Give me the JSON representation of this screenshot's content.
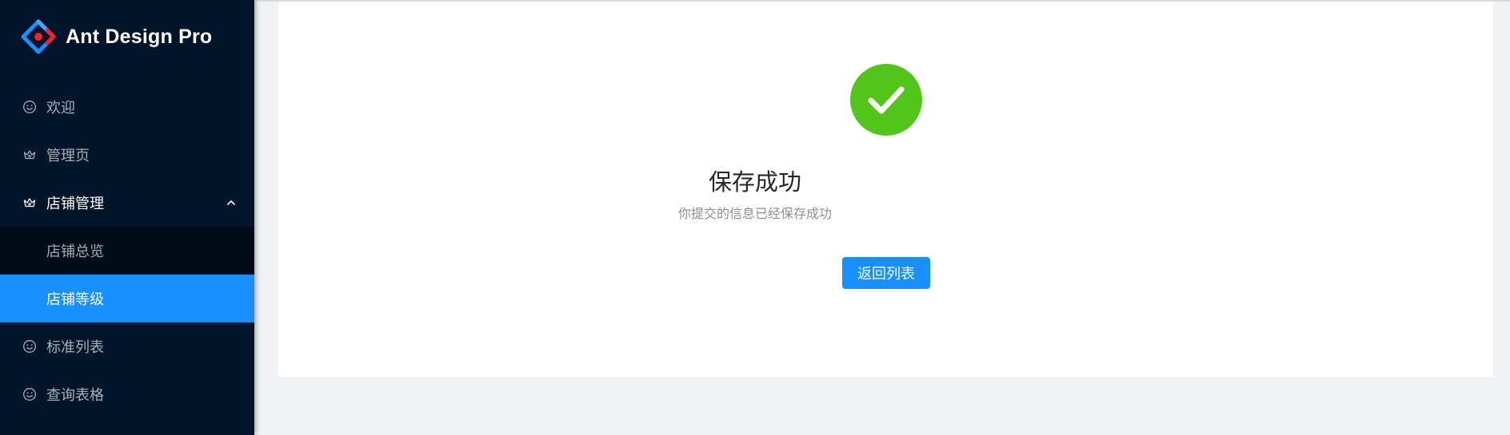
{
  "app": {
    "title": "Ant Design Pro"
  },
  "colors": {
    "sider_bg": "#001529",
    "submenu_bg": "#000c17",
    "primary": "#1890ff",
    "success": "#52c41a"
  },
  "sidebar": {
    "items": [
      {
        "label": "欢迎",
        "icon": "smile-icon"
      },
      {
        "label": "管理页",
        "icon": "crown-icon"
      },
      {
        "label": "店铺管理",
        "icon": "crown-icon",
        "expanded": true,
        "children": [
          {
            "label": "店铺总览"
          },
          {
            "label": "店铺等级",
            "selected": true
          }
        ]
      },
      {
        "label": "标准列表",
        "icon": "smile-icon"
      },
      {
        "label": "查询表格",
        "icon": "smile-icon"
      }
    ]
  },
  "result": {
    "status": "success",
    "icon": "check-circle-icon",
    "title": "保存成功",
    "subtitle": "你提交的信息已经保存成功",
    "button_label": "返回列表"
  }
}
